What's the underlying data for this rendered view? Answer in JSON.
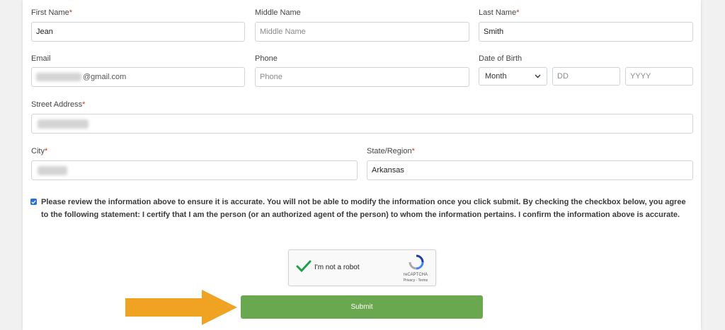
{
  "form": {
    "first_name": {
      "label": "First Name",
      "required": "*",
      "value": "Jean"
    },
    "middle_name": {
      "label": "Middle Name",
      "placeholder": "Middle Name"
    },
    "last_name": {
      "label": "Last Name",
      "required": "*",
      "value": "Smith"
    },
    "email": {
      "label": "Email",
      "value_suffix": "@gmail.com"
    },
    "phone": {
      "label": "Phone",
      "placeholder": "Phone"
    },
    "dob": {
      "label": "Date of Birth",
      "month": "Month",
      "day_placeholder": "DD",
      "year_placeholder": "YYYY"
    },
    "street": {
      "label": "Street Address",
      "required": "*"
    },
    "city": {
      "label": "City",
      "required": "*"
    },
    "state": {
      "label": "State/Region",
      "required": "*",
      "value": "Arkansas"
    }
  },
  "statement": {
    "checked": true,
    "text": "Please review the information above to ensure it is accurate. You will not be able to modify the information once you click submit. By checking the checkbox below, you agree to the following statement: I certify that I am the person (or an authorized agent of the person) to whom the information pertains. I confirm the information above is accurate."
  },
  "captcha": {
    "label": "I'm not a robot",
    "brand": "reCAPTCHA",
    "links": "Privacy - Terms"
  },
  "submit": {
    "label": "Submit"
  },
  "colors": {
    "submit_bg": "#6aa84f",
    "arrow": "#f0a323",
    "required": "#c0392b",
    "check": "#2a70d6"
  }
}
